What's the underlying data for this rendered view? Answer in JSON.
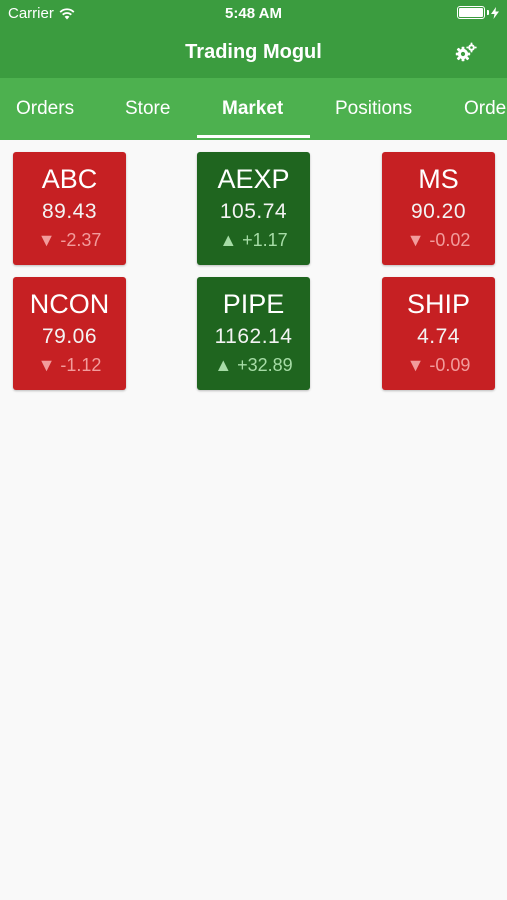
{
  "status_bar": {
    "carrier": "Carrier",
    "time": "5:48 AM"
  },
  "nav": {
    "title": "Trading Mogul",
    "settings_icon": "gears-icon"
  },
  "tabs": [
    {
      "label": "Orders",
      "active": false
    },
    {
      "label": "Store",
      "active": false
    },
    {
      "label": "Market",
      "active": true
    },
    {
      "label": "Positions",
      "active": false
    },
    {
      "label": "Orders",
      "active": false
    }
  ],
  "colors": {
    "primary": "#3b9c3f",
    "tabbar": "#4db14f",
    "down": "#c62023",
    "up": "#1f651f"
  },
  "stocks": [
    {
      "symbol": "ABC",
      "price": "89.43",
      "change": "▼ -2.37",
      "direction": "down"
    },
    {
      "symbol": "AEXP",
      "price": "105.74",
      "change": "▲ +1.17",
      "direction": "up"
    },
    {
      "symbol": "MS",
      "price": "90.20",
      "change": "▼ -0.02",
      "direction": "down"
    },
    {
      "symbol": "NCON",
      "price": "79.06",
      "change": "▼ -1.12",
      "direction": "down"
    },
    {
      "symbol": "PIPE",
      "price": "1162.14",
      "change": "▲ +32.89",
      "direction": "up"
    },
    {
      "symbol": "SHIP",
      "price": "4.74",
      "change": "▼ -0.09",
      "direction": "down"
    }
  ]
}
